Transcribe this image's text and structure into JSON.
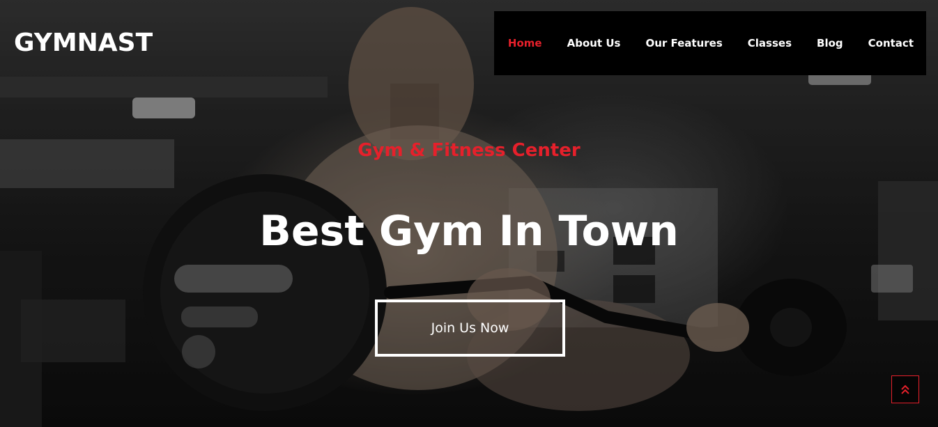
{
  "brand": {
    "logo_text": "GYMNAST"
  },
  "nav": {
    "items": [
      {
        "label": "Home",
        "active": true
      },
      {
        "label": "About Us",
        "active": false
      },
      {
        "label": "Our Features",
        "active": false
      },
      {
        "label": "Classes",
        "active": false
      },
      {
        "label": "Blog",
        "active": false
      },
      {
        "label": "Contact",
        "active": false
      }
    ]
  },
  "hero": {
    "subtitle": "Gym & Fitness Center",
    "headline": "Best Gym In Town",
    "cta_label": "Join Us Now",
    "background": "gym-photo-man-lifting-barbell"
  },
  "scroll_top": {
    "icon": "double-chevron-up-icon"
  },
  "colors": {
    "accent": "#e6202b",
    "nav_background": "#000000",
    "text": "#ffffff"
  }
}
